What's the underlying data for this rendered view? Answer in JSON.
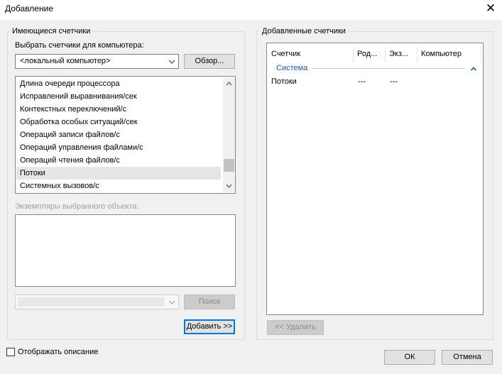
{
  "window": {
    "title": "Добавление",
    "close_glyph": "✕"
  },
  "available": {
    "group_label": "Имеющиеся счетчики",
    "computer_label": "Выбрать счетчики для компьютера:",
    "computer_value": "<локальный компьютер>",
    "browse_label": "Обзор...",
    "counters": [
      "Длина очереди процессора",
      "Исправлений выравнивания/сек",
      "Контекстных переключений/с",
      "Обработка особых ситуаций/сек",
      "Операций записи файлов/с",
      "Операций управления файлами/с",
      "Операций чтения файлов/с",
      "Потоки",
      "Системных вызовов/с"
    ],
    "selected_counter": "Потоки",
    "instances_label": "Экземпляры выбранного объекта:",
    "search_label": "Поиск",
    "add_label": "Добавить >>"
  },
  "added": {
    "group_label": "Добавленные счетчики",
    "columns": [
      "Счетчик",
      "Род...",
      "Экз...",
      "Компьютер"
    ],
    "group_row": "Система",
    "rows": [
      {
        "counter": "Потоки",
        "parent": "---",
        "instance": "---",
        "computer": ""
      }
    ],
    "remove_label": "<< Удалить"
  },
  "footer": {
    "show_description_label": "Отображать описание",
    "show_description_checked": false,
    "ok_label": "ОК",
    "cancel_label": "Отмена"
  },
  "colors": {
    "accent": "#0078d7",
    "group_header_text": "#1e5aa8",
    "selected_row": "#e5e5e5"
  }
}
